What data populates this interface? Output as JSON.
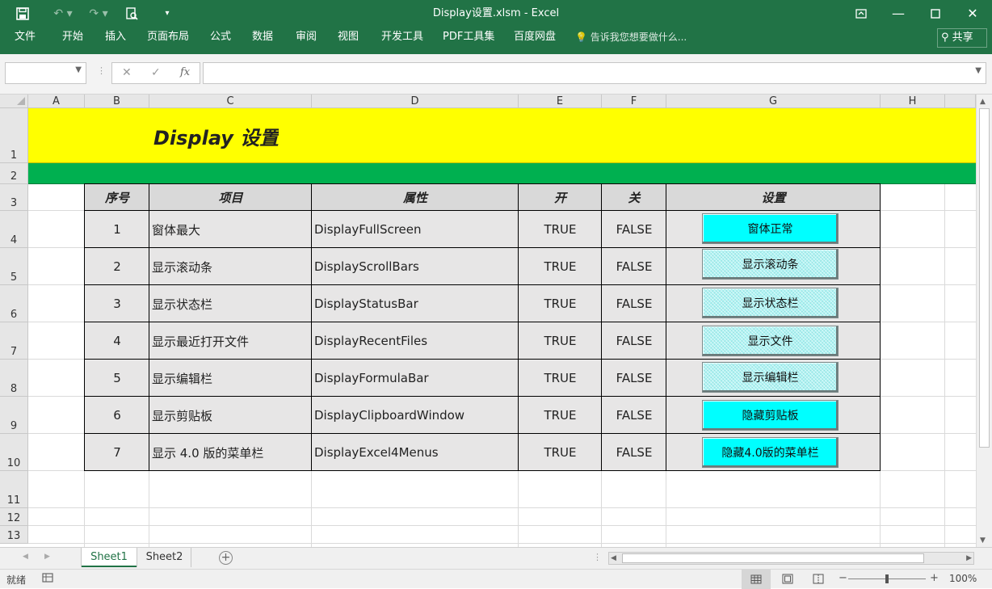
{
  "window": {
    "title": "Display设置.xlsm - Excel"
  },
  "ribbon": {
    "tabs": [
      "文件",
      "开始",
      "插入",
      "页面布局",
      "公式",
      "数据",
      "审阅",
      "视图",
      "开发工具",
      "PDF工具集",
      "百度网盘"
    ],
    "tellme": "告诉我您想要做什么...",
    "share": "共享"
  },
  "formula": {
    "namebox": "",
    "value": "",
    "fx": "fx"
  },
  "columns": [
    "A",
    "B",
    "C",
    "D",
    "E",
    "F",
    "G",
    "H"
  ],
  "rows": [
    "1",
    "2",
    "3",
    "4",
    "5",
    "6",
    "7",
    "8",
    "9",
    "10",
    "11",
    "12",
    "13"
  ],
  "sheet": {
    "title": "Display 设置",
    "header": {
      "no": "序号",
      "item": "项目",
      "prop": "属性",
      "on": "开",
      "off": "关",
      "set": "设置"
    },
    "data": [
      {
        "no": "1",
        "item": "窗体最大",
        "prop": "DisplayFullScreen",
        "on": "TRUE",
        "off": "FALSE",
        "button": "窗体正常"
      },
      {
        "no": "2",
        "item": "显示滚动条",
        "prop": "DisplayScrollBars",
        "on": "TRUE",
        "off": "FALSE",
        "button": "显示滚动条"
      },
      {
        "no": "3",
        "item": "显示状态栏",
        "prop": "DisplayStatusBar",
        "on": "TRUE",
        "off": "FALSE",
        "button": "显示状态栏"
      },
      {
        "no": "4",
        "item": "显示最近打开文件",
        "prop": "DisplayRecentFiles",
        "on": "TRUE",
        "off": "FALSE",
        "button": "显示文件"
      },
      {
        "no": "5",
        "item": "显示编辑栏",
        "prop": "DisplayFormulaBar",
        "on": "TRUE",
        "off": "FALSE",
        "button": "显示编辑栏"
      },
      {
        "no": "6",
        "item": "显示剪贴板",
        "prop": "DisplayClipboardWindow",
        "on": "TRUE",
        "off": "FALSE",
        "button": "隐藏剪贴板"
      },
      {
        "no": "7",
        "item": "显示 4.0 版的菜单栏",
        "prop": "DisplayExcel4Menus",
        "on": "TRUE",
        "off": "FALSE",
        "button": "隐藏4.0版的菜单栏"
      }
    ]
  },
  "sheets": {
    "tab1": "Sheet1",
    "tab2": "Sheet2"
  },
  "status": {
    "ready": "就绪",
    "zoom": "100%"
  },
  "colors": {
    "brand": "#217346",
    "title_fill": "#ffff00",
    "band_fill": "#00b050",
    "table_fill": "#e7e6e6",
    "button_fill": "#00ffff"
  }
}
